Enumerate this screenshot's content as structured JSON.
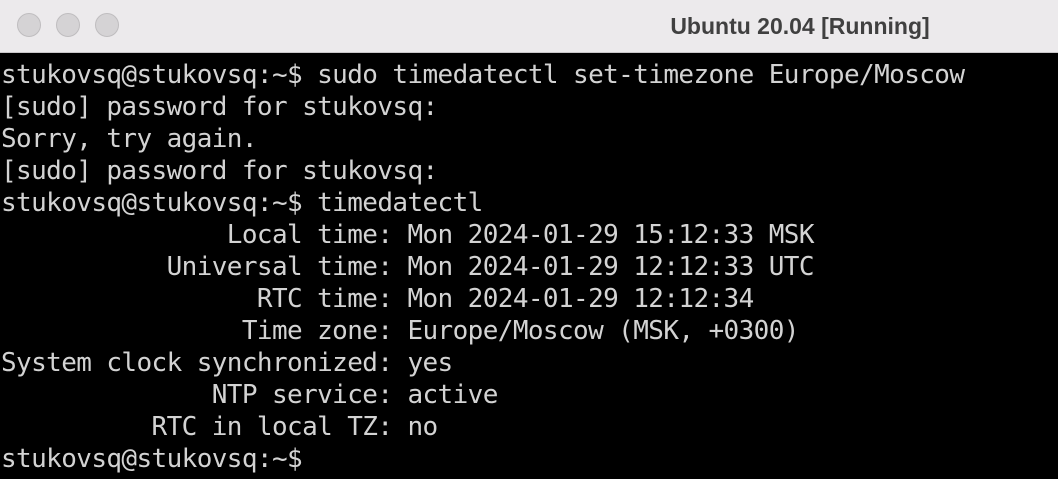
{
  "window": {
    "title": "Ubuntu 20.04 [Running]"
  },
  "terminal": {
    "lines": [
      "stukovsq@stukovsq:~$ sudo timedatectl set-timezone Europe/Moscow",
      "[sudo] password for stukovsq:",
      "Sorry, try again.",
      "[sudo] password for stukovsq:",
      "stukovsq@stukovsq:~$ timedatectl",
      "               Local time: Mon 2024-01-29 15:12:33 MSK",
      "           Universal time: Mon 2024-01-29 12:12:33 UTC",
      "                 RTC time: Mon 2024-01-29 12:12:34",
      "                Time zone: Europe/Moscow (MSK, +0300)",
      "System clock synchronized: yes",
      "              NTP service: active",
      "          RTC in local TZ: no",
      "stukovsq@stukovsq:~$"
    ]
  },
  "colors": {
    "terminal_bg": "#000000",
    "terminal_fg": "#d3d3d3",
    "titlebar_bg": "#eceaec"
  }
}
